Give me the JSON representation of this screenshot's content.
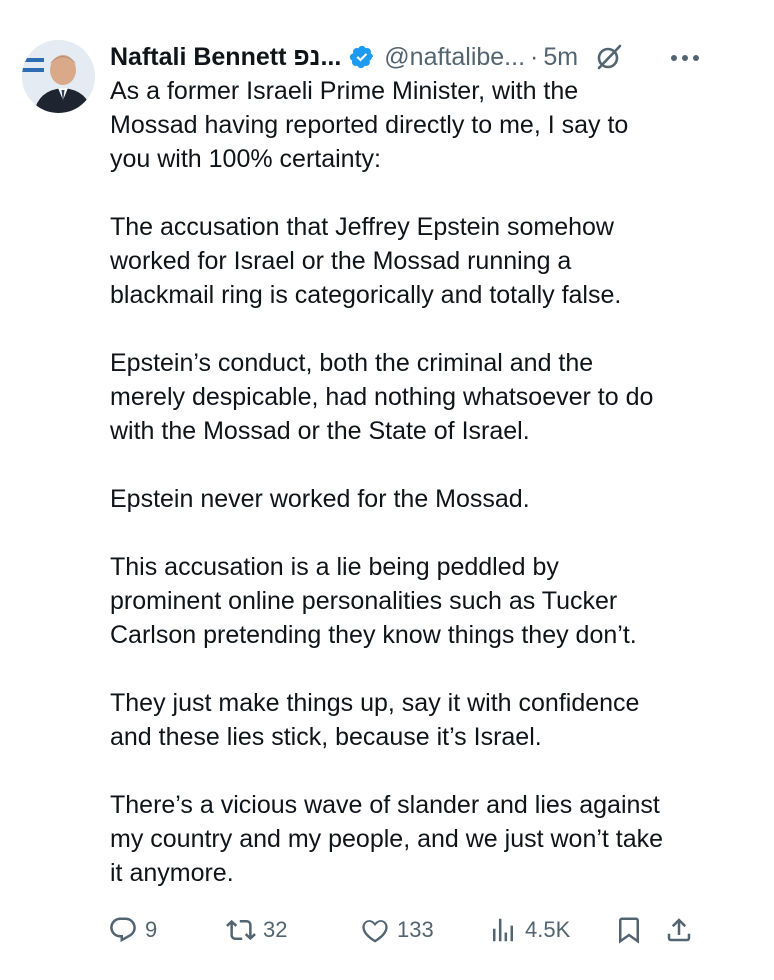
{
  "tweet": {
    "author": {
      "name": "Naftali Bennett נפ...",
      "handle": "@naftalibe...",
      "time": "5m",
      "separator": "·"
    },
    "paragraphs": [
      "As a former Israeli Prime Minister, with the\nMossad having reported directly to me, I say to\nyou with 100% certainty:",
      "The accusation that Jeffrey Epstein somehow\nworked for Israel or the Mossad running a\nblackmail ring is categorically and totally false.",
      "Epstein’s conduct, both the criminal and the\nmerely despicable, had nothing whatsoever to do\nwith the Mossad or the State of Israel.",
      "Epstein never worked for the Mossad.",
      "This accusation is a lie being peddled by\nprominent online personalities such as Tucker\nCarlson pretending they know things they don’t.",
      "They just make things up, say it with confidence\nand these lies stick, because it’s Israel.",
      "There’s a vicious wave of slander and lies against\nmy country and my people, and we just won’t take\nit anymore."
    ],
    "stats": {
      "replies": "9",
      "reposts": "32",
      "likes": "133",
      "views": "4.5K"
    },
    "icons": {
      "verified": "verified-badge-icon",
      "grok": "grok-icon",
      "more": "more-options-icon",
      "reply": "reply-icon",
      "repost": "repost-icon",
      "like": "like-icon",
      "views": "views-icon",
      "bookmark": "bookmark-icon",
      "share": "share-icon"
    },
    "colors": {
      "text": "#0f1419",
      "secondary": "#536471",
      "verified": "#1d9bf0"
    }
  }
}
